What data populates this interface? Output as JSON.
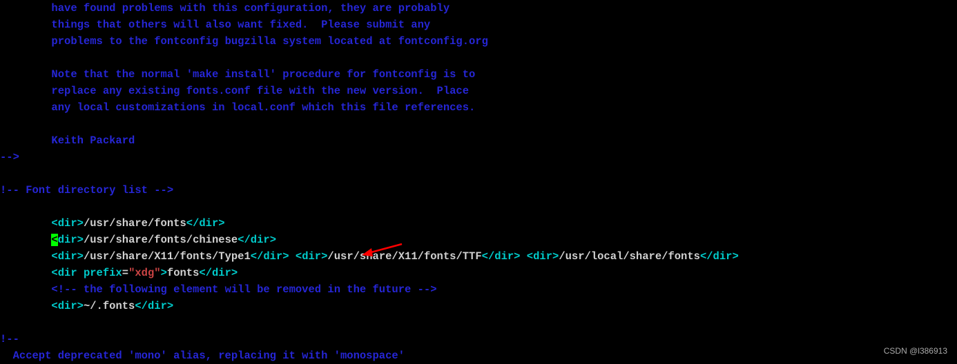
{
  "indent_body": "        ",
  "lines": {
    "c1": "have found problems with this configuration, they are probably",
    "c2": "things that others will also want fixed.  Please submit any",
    "c3": "problems to the fontconfig bugzilla system located at fontconfig.org",
    "c4": "Note that the normal 'make install' procedure for fontconfig is to",
    "c5": "replace any existing fonts.conf file with the new version.  Place",
    "c6": "any local customizations in local.conf which this file references.",
    "c7": "Keith Packard",
    "end1": "-->",
    "fdl": "!-- Font directory list -->",
    "dir_open": "<dir>",
    "dir_close": "</dir>",
    "cursor_char": "<",
    "cursor_rest": "dir>",
    "v1": "/usr/share/fonts",
    "v2": "/usr/share/fonts/chinese",
    "v3a": "/usr/share/X11/fonts/Type1",
    "v3b": "/usr/share/X11/fonts/TTF",
    "v3c": "/usr/local/share/fonts",
    "dir_prefix_open": "<dir ",
    "attr_prefix": "prefix",
    "eq": "=",
    "attr_val": "\"xdg\"",
    "close_angle": ">",
    "v4": "fonts",
    "removed": "<!-- the following element will be removed in the future -->",
    "v5": "~/.fonts",
    "excl": "!--",
    "mono": "  Accept deprecated 'mono' alias, replacing it with 'monospace'"
  },
  "watermark": "CSDN @l386913"
}
